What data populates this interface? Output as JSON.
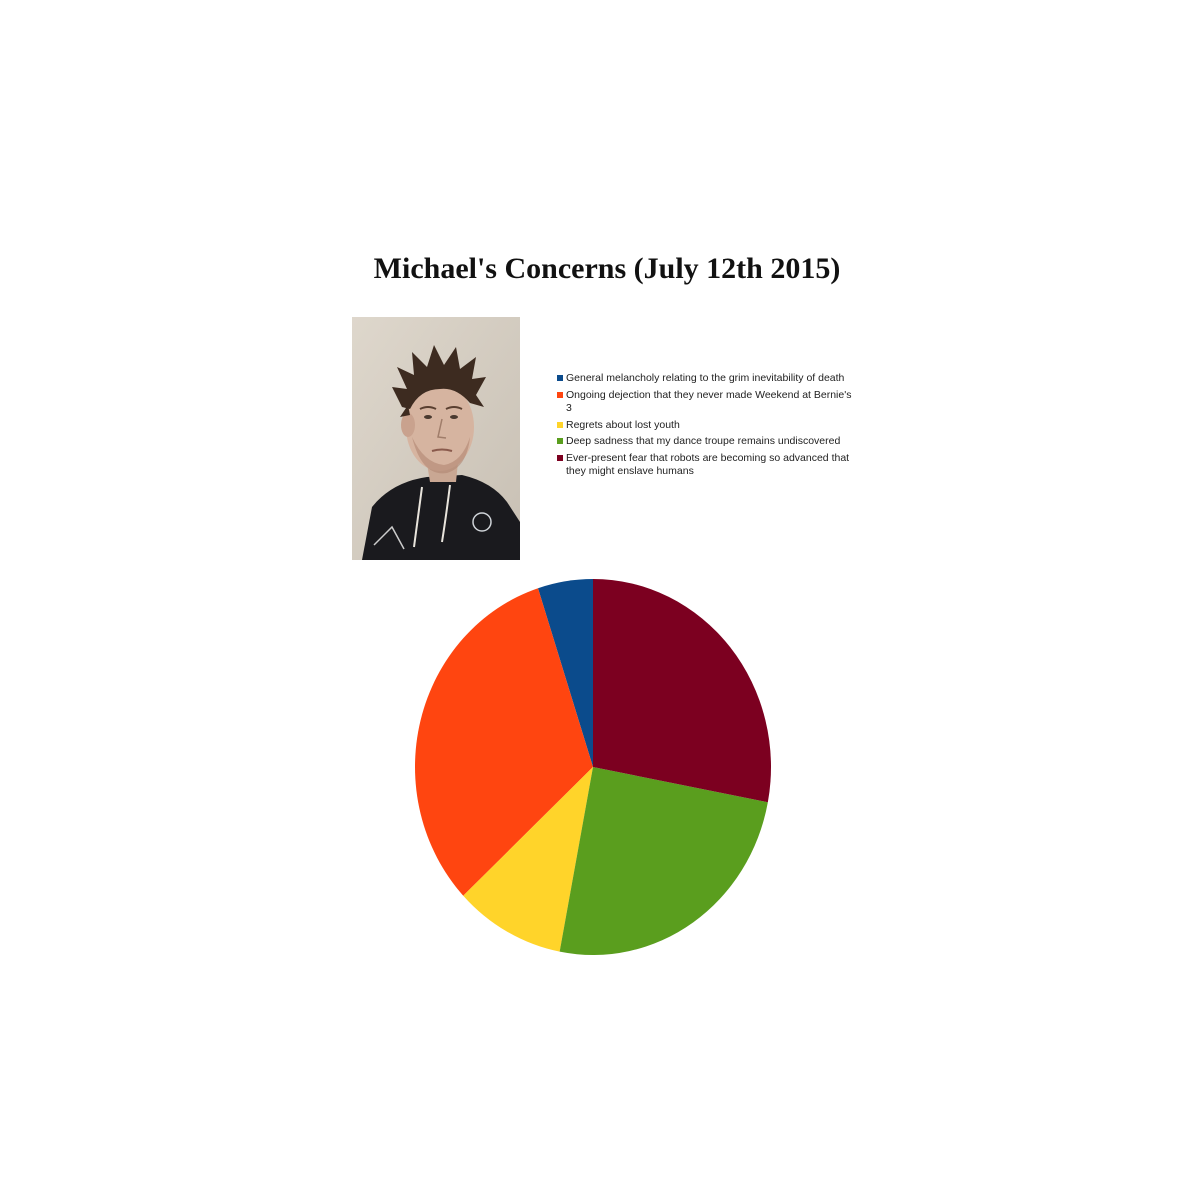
{
  "chart_data": {
    "type": "pie",
    "title": "Michael's Concerns (July 12th 2015)",
    "legend_position": "right",
    "categories": [
      "General melancholy relating to the grim inevitability of death",
      "Ongoing dejection that they never made Weekend at Bernie's 3",
      "Regrets about lost youth",
      "Deep sadness that my dance troupe remains undiscovered",
      "Ever-present fear that robots are becoming so advanced that they might enslave humans"
    ],
    "values": [
      5,
      32,
      10,
      25,
      28
    ],
    "colors": [
      "#0b4b8c",
      "#ff4510",
      "#ffd42a",
      "#5a9e1e",
      "#7c0020"
    ],
    "start_angle_deg": 0,
    "direction": "counterclockwise"
  },
  "photo": {
    "icon": "portrait-photo"
  }
}
